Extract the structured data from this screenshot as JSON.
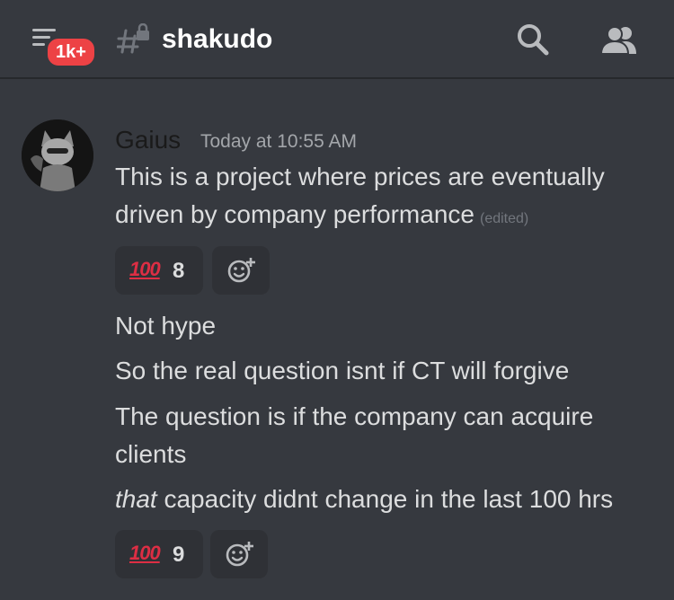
{
  "header": {
    "badge": "1k+",
    "channel_name": "shakudo"
  },
  "message": {
    "author": "Gaius",
    "timestamp": "Today at 10:55 AM",
    "lines": [
      "This is a project where prices are eventually",
      "driven by company performance"
    ],
    "edited": "(edited)",
    "reaction_1": {
      "emoji": "100",
      "count": "8"
    },
    "followups": [
      "Not hype",
      "So the real question isnt if CT will forgive",
      "The question is if the company can acquire",
      "clients"
    ],
    "last_line": {
      "italic": "that",
      "rest": " capacity didnt change in the last 100 hrs"
    },
    "reaction_2": {
      "emoji": "100",
      "count": "9"
    }
  },
  "colors": {
    "background": "#36393f",
    "reaction_bg": "#2f3136",
    "badge": "#ed4245",
    "emoji_red": "#dd2e44"
  },
  "icons": [
    "menu-icon",
    "locked-channel-icon",
    "search-icon",
    "members-icon",
    "add-reaction-icon"
  ]
}
